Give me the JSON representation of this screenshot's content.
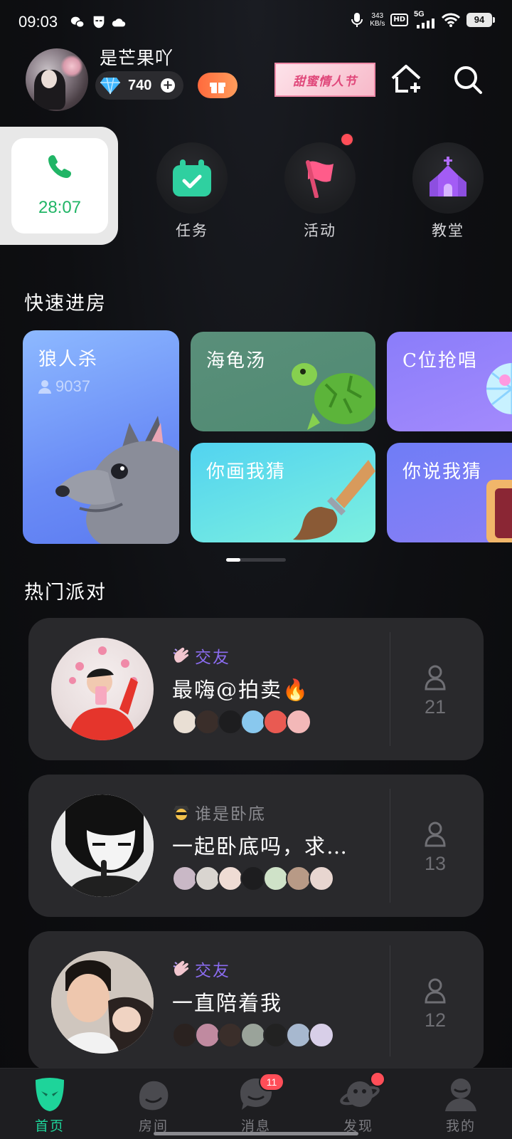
{
  "status_bar": {
    "time": "09:03",
    "net_speed": "343",
    "net_unit": "KB/s",
    "hd": "HD",
    "signal": "5G",
    "battery": "94"
  },
  "header": {
    "username": "是芒果吖",
    "diamonds": "740",
    "plus": "+",
    "banner_text": "甜蜜情人节"
  },
  "call_widget": {
    "duration": "28:07"
  },
  "shortcuts": [
    {
      "label": "任务",
      "icon": "calendar-check-icon"
    },
    {
      "label": "活动",
      "icon": "flag-icon"
    },
    {
      "label": "教堂",
      "icon": "church-icon"
    }
  ],
  "quick_rooms": {
    "title": "快速进房",
    "rooms": [
      {
        "name": "狼人杀",
        "count": "9037"
      },
      {
        "name": "海龟汤"
      },
      {
        "name": "C位抢唱"
      },
      {
        "name": "你画我猜"
      },
      {
        "name": "你说我猜"
      }
    ]
  },
  "hot_party": {
    "title": "热门派对",
    "parties": [
      {
        "tag": "交友",
        "title": "最嗨@拍卖🔥",
        "online": "21",
        "tag_color": "#8b6cf0"
      },
      {
        "tag": "谁是卧底",
        "title": "一起卧底吗，求…",
        "online": "13",
        "tag_color": "#8a8a8f"
      },
      {
        "tag": "交友",
        "title": "一直陪着我",
        "online": "12",
        "tag_color": "#8b6cf0"
      }
    ]
  },
  "bottom_nav": {
    "items": [
      {
        "label": "首页",
        "active": true
      },
      {
        "label": "房间"
      },
      {
        "label": "消息",
        "badge": "11"
      },
      {
        "label": "发现"
      },
      {
        "label": "我的"
      }
    ]
  },
  "colors": {
    "accent_green": "#1ed49a",
    "call_green": "#21b566",
    "badge_red": "#ff4e58",
    "tag_purple": "#8b6cf0"
  }
}
